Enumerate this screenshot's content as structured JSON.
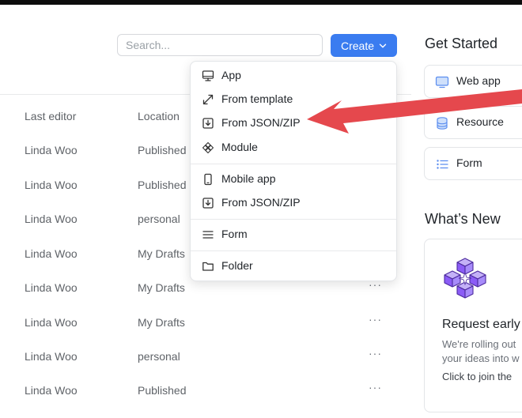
{
  "search": {
    "placeholder": "Search..."
  },
  "create_button": {
    "label": "Create"
  },
  "table": {
    "columns": [
      "Last editor",
      "Location"
    ],
    "rows": [
      {
        "editor": "Linda Woo",
        "location": "Published"
      },
      {
        "editor": "Linda Woo",
        "location": "Published"
      },
      {
        "editor": "Linda Woo",
        "location": "personal"
      },
      {
        "editor": "Linda Woo",
        "location": "My Drafts"
      },
      {
        "editor": "Linda Woo",
        "location": "My Drafts"
      },
      {
        "editor": "Linda Woo",
        "location": "My Drafts"
      },
      {
        "editor": "Linda Woo",
        "location": "personal"
      },
      {
        "editor": "Linda Woo",
        "location": "Published"
      }
    ],
    "row_menu": "···"
  },
  "create_menu": {
    "items": [
      {
        "label": "App",
        "icon": "monitor-icon"
      },
      {
        "label": "From template",
        "icon": "expand-arrows-icon"
      },
      {
        "label": "From JSON/ZIP",
        "icon": "import-download-icon"
      },
      {
        "label": "Module",
        "icon": "module-diamond-icon"
      },
      {
        "label": "Mobile app",
        "icon": "mobile-phone-icon"
      },
      {
        "label": "From JSON/ZIP",
        "icon": "import-download-icon"
      },
      {
        "label": "Form",
        "icon": "form-lines-icon"
      },
      {
        "label": "Folder",
        "icon": "folder-icon"
      }
    ]
  },
  "get_started": {
    "title": "Get Started",
    "items": [
      {
        "label": "Web app",
        "icon": "web-app-icon"
      },
      {
        "label": "Resource",
        "icon": "database-icon"
      },
      {
        "label": "Form",
        "icon": "list-icon"
      }
    ]
  },
  "whats_new": {
    "title": "What’s New",
    "card_title": "Request early",
    "body_line1": "We're rolling out",
    "body_line2": "your ideas into w",
    "link": "Click to join the"
  },
  "colors": {
    "accent": "#3a7cf0",
    "arrow": "#e5484d",
    "illustration": "#8b5cf6"
  }
}
